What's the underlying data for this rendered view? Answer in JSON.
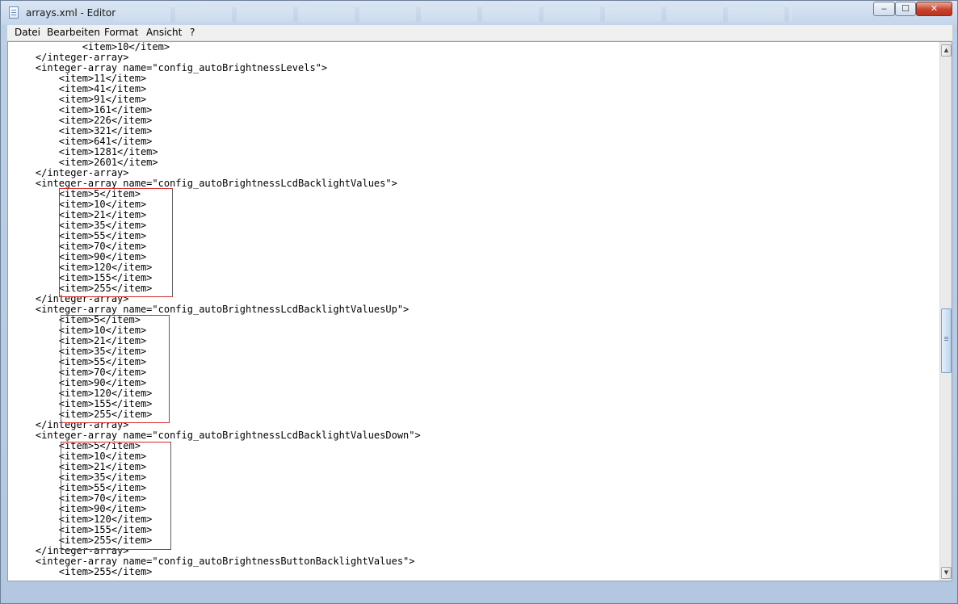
{
  "window": {
    "title": "arrays.xml - Editor",
    "controls": {
      "minimize": "‒",
      "maximize": "☐",
      "close": "✕"
    }
  },
  "menu": [
    "Datei",
    "Bearbeiten",
    "Format",
    "Ansicht",
    "?"
  ],
  "editor": {
    "lines": [
      "            <item>10</item>",
      "    </integer-array>",
      "    <integer-array name=\"config_autoBrightnessLevels\">",
      "        <item>11</item>",
      "        <item>41</item>",
      "        <item>91</item>",
      "        <item>161</item>",
      "        <item>226</item>",
      "        <item>321</item>",
      "        <item>641</item>",
      "        <item>1281</item>",
      "        <item>2601</item>",
      "    </integer-array>",
      "    <integer-array name=\"config_autoBrightnessLcdBacklightValues\">",
      "        <item>5</item>",
      "        <item>10</item>",
      "        <item>21</item>",
      "        <item>35</item>",
      "        <item>55</item>",
      "        <item>70</item>",
      "        <item>90</item>",
      "        <item>120</item>",
      "        <item>155</item>",
      "        <item>255</item>",
      "    </integer-array>",
      "    <integer-array name=\"config_autoBrightnessLcdBacklightValuesUp\">",
      "        <item>5</item>",
      "        <item>10</item>",
      "        <item>21</item>",
      "        <item>35</item>",
      "        <item>55</item>",
      "        <item>70</item>",
      "        <item>90</item>",
      "        <item>120</item>",
      "        <item>155</item>",
      "        <item>255</item>",
      "    </integer-array>",
      "    <integer-array name=\"config_autoBrightnessLcdBacklightValuesDown\">",
      "        <item>5</item>",
      "        <item>10</item>",
      "        <item>21</item>",
      "        <item>35</item>",
      "        <item>55</item>",
      "        <item>70</item>",
      "        <item>90</item>",
      "        <item>120</item>",
      "        <item>155</item>",
      "        <item>255</item>",
      "    </integer-array>",
      "    <integer-array name=\"config_autoBrightnessButtonBacklightValues\">",
      "        <item>255</item>"
    ]
  },
  "scrollbar": {
    "up_arrow": "▲",
    "down_arrow": "▼"
  },
  "colors": {
    "highlight_border": "#d42a2a"
  }
}
